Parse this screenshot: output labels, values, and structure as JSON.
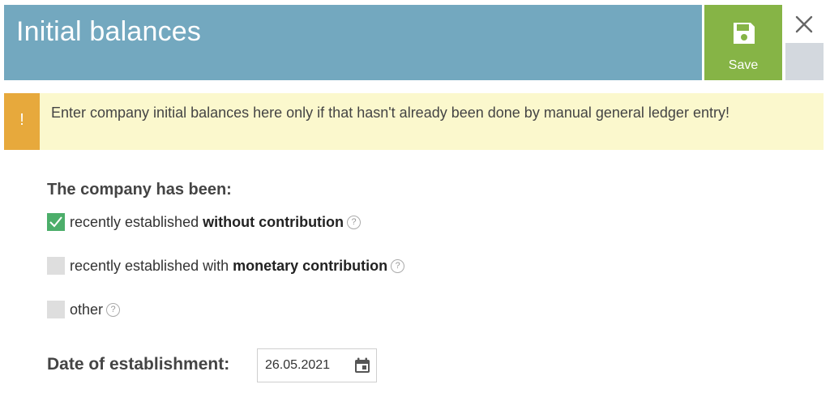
{
  "header": {
    "title": "Initial balances",
    "save_label": "Save"
  },
  "warning": {
    "icon": "!",
    "text": "Enter company initial balances here only if that hasn't already been done by manual general ledger entry!"
  },
  "form": {
    "heading": "The company has been:",
    "options": [
      {
        "prefix": "recently established ",
        "bold": "without contribution",
        "checked": true
      },
      {
        "prefix": "recently established with ",
        "bold": "monetary contribution",
        "checked": false
      },
      {
        "prefix": "other",
        "bold": "",
        "checked": false
      }
    ],
    "help_symbol": "?",
    "date_label": "Date of establishment:",
    "date_value": "26.05.2021"
  },
  "colors": {
    "header_bg": "#73a8bf",
    "save_bg": "#86b446",
    "warning_bg": "#fbf8cd",
    "warning_accent": "#e7a93c",
    "checked": "#4cae6a"
  },
  "icons": {
    "save": "floppy-disk-icon",
    "close": "close-icon",
    "warning": "exclamation-icon",
    "check": "checkmark-icon",
    "help": "question-circle-icon",
    "calendar": "calendar-icon"
  }
}
